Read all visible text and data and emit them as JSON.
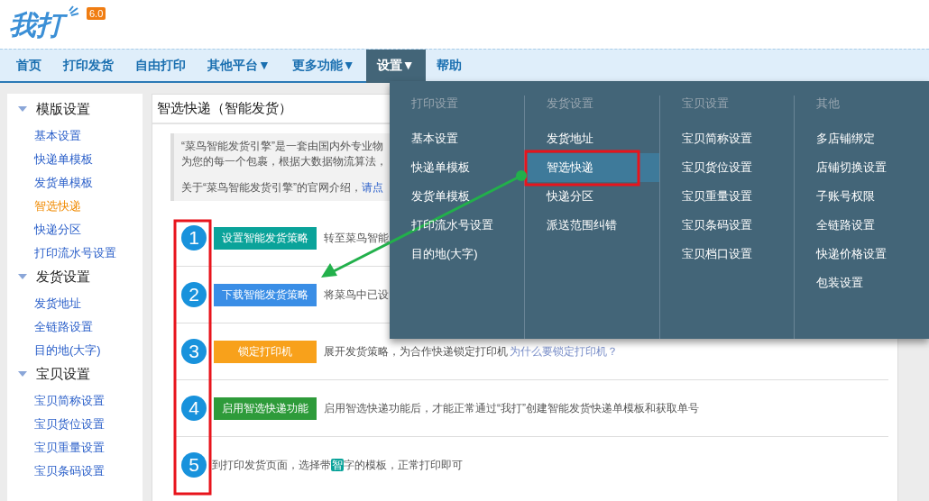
{
  "logo": {
    "name": "我打",
    "version": "6.0"
  },
  "nav": [
    {
      "label": "首页",
      "selected": false
    },
    {
      "label": "打印发货",
      "selected": false
    },
    {
      "label": "自由打印",
      "selected": false
    },
    {
      "label": "其他平台▼",
      "selected": false
    },
    {
      "label": "更多功能▼",
      "selected": false
    },
    {
      "label": "设置▼",
      "selected": true
    },
    {
      "label": "帮助",
      "selected": false
    }
  ],
  "sidebar": [
    {
      "title": "模版设置",
      "items": [
        {
          "label": "基本设置",
          "selected": false
        },
        {
          "label": "快递单模板",
          "selected": false
        },
        {
          "label": "发货单模板",
          "selected": false
        },
        {
          "label": "智选快递",
          "selected": true
        },
        {
          "label": "快递分区",
          "selected": false
        },
        {
          "label": "打印流水号设置",
          "selected": false
        }
      ]
    },
    {
      "title": "发货设置",
      "items": [
        {
          "label": "发货地址",
          "selected": false
        },
        {
          "label": "全链路设置",
          "selected": false
        },
        {
          "label": "目的地(大字)",
          "selected": false
        }
      ]
    },
    {
      "title": "宝贝设置",
      "items": [
        {
          "label": "宝贝简称设置",
          "selected": false
        },
        {
          "label": "宝贝货位设置",
          "selected": false
        },
        {
          "label": "宝贝重量设置",
          "selected": false
        },
        {
          "label": "宝贝条码设置",
          "selected": false
        }
      ]
    }
  ],
  "panel": {
    "title": "智选快递（智能发货）",
    "intro": [
      "“菜鸟智能发货引擎”是一套由国内外专业物",
      "为您的每一个包裹，根据大数据物流算法，"
    ],
    "intro_link_prefix": "关于“菜鸟智能发货引擎”的官网介绍，",
    "intro_link": "请点",
    "steps": [
      {
        "number": "1",
        "button": "设置智能发货策略",
        "color": "#0aa39a",
        "text": "转至菜鸟智能"
      },
      {
        "number": "2",
        "button": "下载智能发货策略",
        "color": "#3a8ee6",
        "text": "将菜鸟中已设"
      },
      {
        "number": "3",
        "button": "锁定打印机",
        "color": "#f8a11b",
        "text": "展开发货策略，为合作快递锁定打印机",
        "link": "为什么要锁定打印机？"
      },
      {
        "number": "4",
        "button": "启用智选快递功能",
        "color": "#2e9b3a",
        "text": "启用智选快递功能后，才能正常通过“我打”创建智能发货快递单模板和获取单号"
      },
      {
        "number": "5",
        "text_before": "到打印发货页面，选择带",
        "badge": "智",
        "text_after": "字的模板，正常打印即可"
      }
    ]
  },
  "menu": [
    {
      "heading": "打印设置",
      "items": [
        {
          "label": "基本设置",
          "selected": false
        },
        {
          "label": "快递单模板",
          "selected": false
        },
        {
          "label": "发货单模板",
          "selected": false
        },
        {
          "label": "打印流水号设置",
          "selected": false
        },
        {
          "label": "目的地(大字)",
          "selected": false
        }
      ]
    },
    {
      "heading": "发货设置",
      "items": [
        {
          "label": "发货地址",
          "selected": false
        },
        {
          "label": "智选快递",
          "selected": true
        },
        {
          "label": "快递分区",
          "selected": false
        },
        {
          "label": "派送范围纠错",
          "selected": false
        }
      ]
    },
    {
      "heading": "宝贝设置",
      "items": [
        {
          "label": "宝贝简称设置",
          "selected": false
        },
        {
          "label": "宝贝货位设置",
          "selected": false
        },
        {
          "label": "宝贝重量设置",
          "selected": false
        },
        {
          "label": "宝贝条码设置",
          "selected": false
        },
        {
          "label": "宝贝档口设置",
          "selected": false
        }
      ]
    },
    {
      "heading": "其他",
      "items": [
        {
          "label": "多店铺绑定",
          "selected": false
        },
        {
          "label": "店铺切换设置",
          "selected": false
        },
        {
          "label": "子账号权限",
          "selected": false
        },
        {
          "label": "全链路设置",
          "selected": false
        },
        {
          "label": "快递价格设置",
          "selected": false
        },
        {
          "label": "包装设置",
          "selected": false
        }
      ]
    }
  ]
}
